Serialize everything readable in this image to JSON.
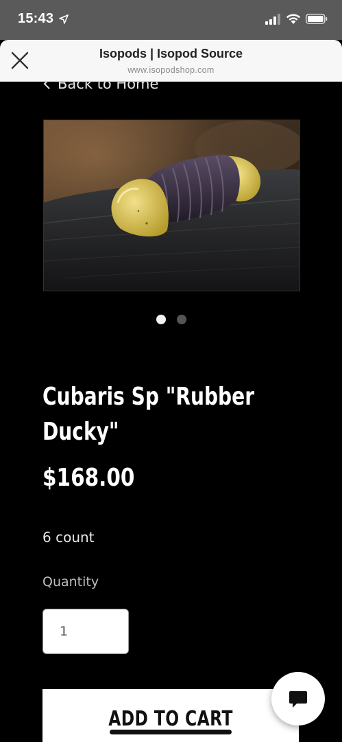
{
  "status_bar": {
    "time": "15:43",
    "location_icon": "location-arrow-icon",
    "signal_icon": "cellular-signal-icon",
    "wifi_icon": "wifi-icon",
    "battery_icon": "battery-icon"
  },
  "browser": {
    "title": "Isopods | Isopod Source",
    "url": "www.isopodshop.com",
    "close_icon": "close-icon"
  },
  "nav": {
    "back_label": "Back to Home"
  },
  "product": {
    "image_icon": "product-photo",
    "carousel": {
      "count": 2,
      "active_index": 0
    },
    "title": "Cubaris Sp \"Rubber Ducky\"",
    "price": "$168.00",
    "count_text": "6 count",
    "quantity_label": "Quantity",
    "quantity_value": "1",
    "add_to_cart_label": "ADD TO CART"
  },
  "chat": {
    "icon": "chat-bubble-icon"
  },
  "colors": {
    "background": "#000000",
    "status_bar": "#5a5a5a",
    "header": "#f7f7f7",
    "button": "#ffffff"
  }
}
